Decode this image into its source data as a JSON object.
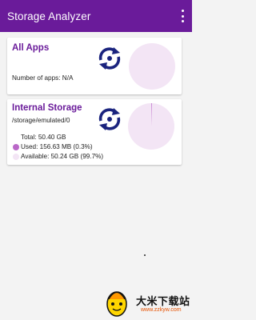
{
  "app": {
    "title": "Storage Analyzer",
    "primary_color": "#6a1b9a",
    "menu_icon": "more-vert-icon"
  },
  "all_apps_card": {
    "title": "All Apps",
    "count_text": "Number of apps: N/A",
    "refresh_icon": "refresh-icon",
    "pie_color": "#f3e5f5"
  },
  "internal_storage_card": {
    "title": "Internal Storage",
    "path": "/storage/emulated/0",
    "total_text": "Total: 50.40 GB",
    "used_text": "Used: 156.63 MB (0.3%)",
    "available_text": "Available: 50.24 GB (99.7%)",
    "used_fraction": 0.003,
    "used_color": "#ba68c8",
    "available_color": "#f3e5f5",
    "refresh_icon": "refresh-icon"
  },
  "watermark": {
    "text": "大米下载站",
    "url": "www.zzkyw.com"
  }
}
